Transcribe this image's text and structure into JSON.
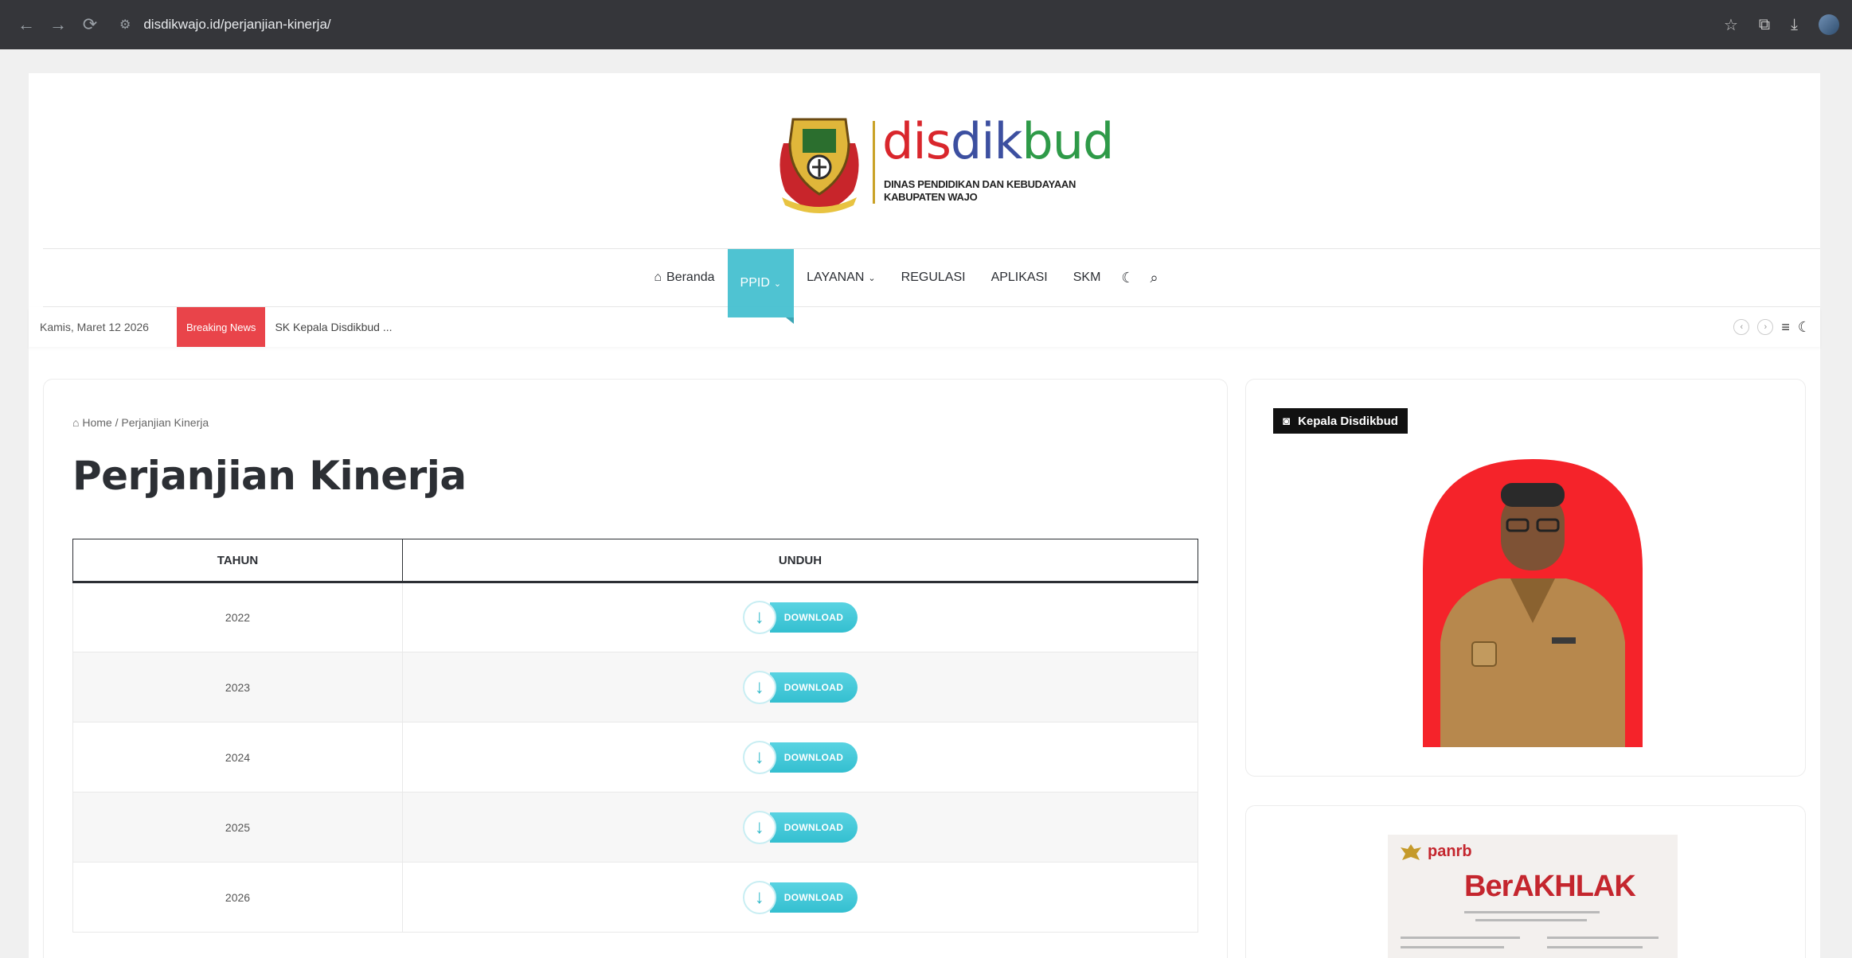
{
  "browser": {
    "url": "disdikwajo.id/perjanjian-kinerja/"
  },
  "logo": {
    "word_part1": "dis",
    "word_part2": "dik",
    "word_part3": "bud",
    "subtitle_line1": "DINAS PENDIDIKAN DAN KEBUDAYAAN",
    "subtitle_line2": "KABUPATEN WAJO"
  },
  "nav": {
    "items": [
      {
        "label": "Beranda",
        "icon": "home-icon"
      },
      {
        "label": "PPID",
        "dropdown": true,
        "active": true
      },
      {
        "label": "LAYANAN",
        "dropdown": true
      },
      {
        "label": "REGULASI"
      },
      {
        "label": "APLIKASI"
      },
      {
        "label": "SKM"
      }
    ]
  },
  "topbar": {
    "date": "Kamis, Maret 12 2026",
    "breaking_label": "Breaking News",
    "ticker": "SK Kepala Disdikbud ..."
  },
  "breadcrumb": {
    "home": "Home",
    "separator": "/",
    "current": "Perjanjian Kinerja"
  },
  "page_title": "Perjanjian Kinerja",
  "table": {
    "headers": [
      "TAHUN",
      "UNDUH"
    ],
    "rows": [
      {
        "year": "2022",
        "button": "DOWNLOAD"
      },
      {
        "year": "2023",
        "button": "DOWNLOAD"
      },
      {
        "year": "2024",
        "button": "DOWNLOAD"
      },
      {
        "year": "2025",
        "button": "DOWNLOAD"
      },
      {
        "year": "2026",
        "button": "DOWNLOAD"
      }
    ]
  },
  "sidebar": {
    "widget_title": "Kepala Disdikbud",
    "banner": {
      "org": "panrb",
      "headline": "BerAKHLAK"
    }
  },
  "colors": {
    "accent": "#4fc3d2",
    "breaking": "#e9444a",
    "portrait_bg": "#f5232a"
  }
}
